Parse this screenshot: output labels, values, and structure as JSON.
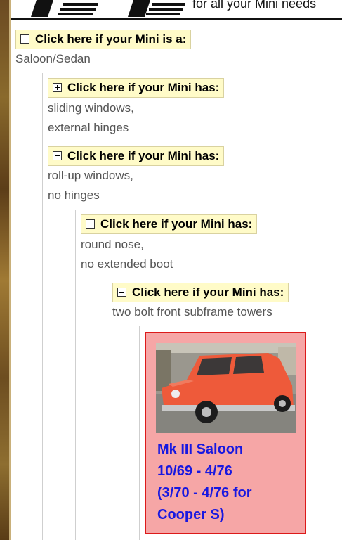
{
  "header": {
    "tagline": "for all your Mini needs"
  },
  "level1": {
    "toggle_label": "Click here if your Mini is a:",
    "toggle_state": "expanded",
    "value": "Saloon/Sedan"
  },
  "level2": [
    {
      "toggle_label": "Click here if your Mini has:",
      "toggle_state": "collapsed",
      "lines": [
        "sliding windows,",
        "external hinges"
      ]
    },
    {
      "toggle_label": "Click here if your Mini has:",
      "toggle_state": "expanded",
      "lines": [
        "roll-up windows,",
        "no hinges"
      ]
    }
  ],
  "level3": {
    "toggle_label": "Click here if your Mini has:",
    "toggle_state": "expanded",
    "lines": [
      "round nose,",
      "no extended boot"
    ]
  },
  "level4": {
    "toggle_label": "Click here if your Mini has:",
    "toggle_state": "expanded",
    "lines": [
      "two bolt front subframe towers"
    ]
  },
  "result_card": {
    "lines": [
      "Mk III Saloon",
      "10/69 - 4/76",
      "(3/70 - 4/76 for",
      "Cooper S)"
    ]
  },
  "colors": {
    "toggle_bg": "#fffbc8",
    "link": "#1818e0",
    "card_bg": "#f6a6a6",
    "card_border": "#dc1a1a"
  }
}
